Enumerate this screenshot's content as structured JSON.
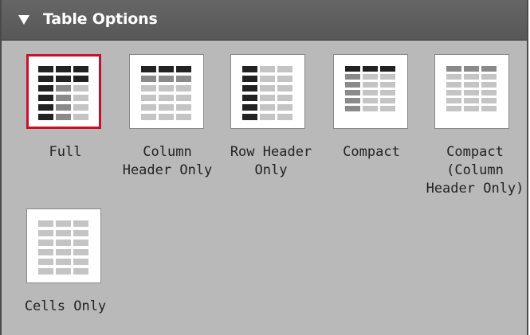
{
  "panel": {
    "title": "Table Options",
    "collapse_icon": "triangle-down-icon"
  },
  "options": [
    {
      "id": "full",
      "label": "Full",
      "selected": true,
      "header_row": true,
      "header_col": true,
      "compact": false,
      "colors": {
        "header": "#222222",
        "sub": "#8a8a8a",
        "cell": "#c4c4c4"
      }
    },
    {
      "id": "column-header-only",
      "label": "Column\nHeader Only",
      "selected": false,
      "header_row": true,
      "header_col": false,
      "compact": false,
      "colors": {
        "header": "#222222",
        "sub": "#8a8a8a",
        "cell": "#c4c4c4"
      }
    },
    {
      "id": "row-header-only",
      "label": "Row Header\nOnly",
      "selected": false,
      "header_row": false,
      "header_col": true,
      "compact": false,
      "colors": {
        "header": "#222222",
        "sub": "#8a8a8a",
        "cell": "#c4c4c4"
      }
    },
    {
      "id": "compact",
      "label": "Compact",
      "selected": false,
      "header_row": true,
      "header_col": true,
      "compact": true,
      "colors": {
        "header": "#222222",
        "sub": "#8a8a8a",
        "cell": "#c4c4c4"
      }
    },
    {
      "id": "compact-column-header-only",
      "label": "Compact\n(Column\nHeader Only)",
      "selected": false,
      "header_row": true,
      "header_col": false,
      "compact": true,
      "colors": {
        "header": "#8a8a8a",
        "sub": "#8a8a8a",
        "cell": "#c4c4c4"
      }
    },
    {
      "id": "cells-only",
      "label": "Cells Only",
      "selected": false,
      "header_row": false,
      "header_col": false,
      "compact": false,
      "colors": {
        "header": "#c4c4c4",
        "sub": "#c4c4c4",
        "cell": "#c4c4c4"
      }
    }
  ]
}
